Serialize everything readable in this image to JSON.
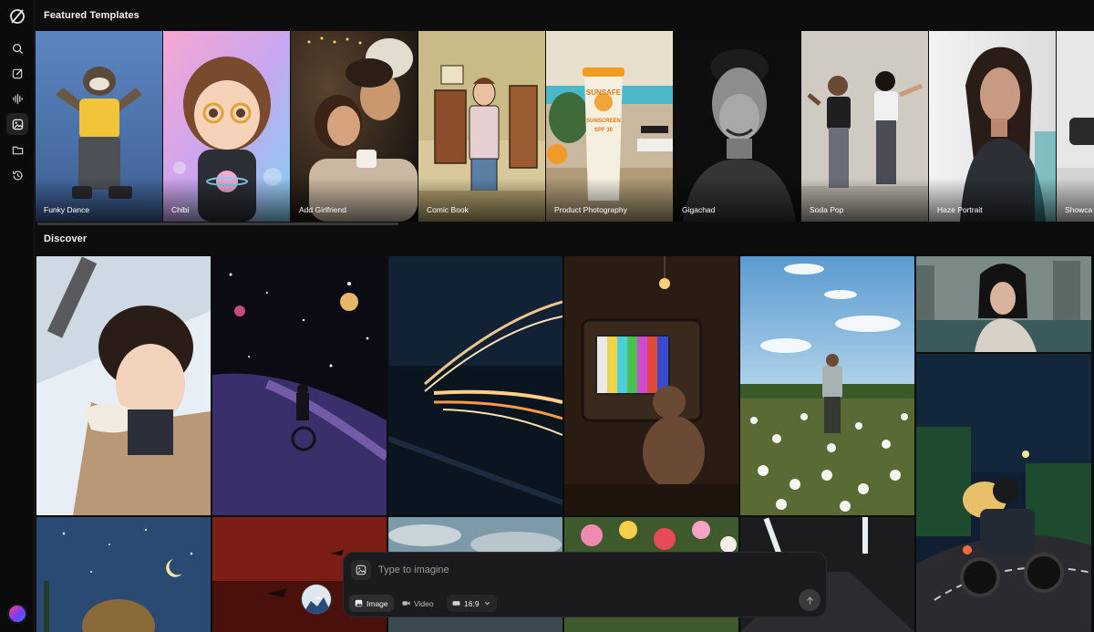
{
  "sections": {
    "featured_title": "Featured Templates",
    "discover_title": "Discover"
  },
  "templates": [
    {
      "label": "Funky Dance"
    },
    {
      "label": "Chibi"
    },
    {
      "label": "Add Girlfriend"
    },
    {
      "label": "Comic Book"
    },
    {
      "label": "Product Photography"
    },
    {
      "label": "Gigachad"
    },
    {
      "label": "Soda Pop"
    },
    {
      "label": "Haze Portrait"
    },
    {
      "label": "Showca"
    }
  ],
  "product": {
    "brand": "SUNSAFE",
    "line": "SUNSCREEN",
    "spf": "SPF 30"
  },
  "prompt": {
    "placeholder": "Type to imagine",
    "mode_image": "Image",
    "mode_video": "Video",
    "aspect": "16:9"
  },
  "icons": {
    "logo": "logo-icon",
    "search": "search-icon",
    "edit": "edit-icon",
    "audio": "waveform-icon",
    "gallery": "gallery-icon",
    "folder": "folder-icon",
    "history": "history-icon"
  },
  "colors": {
    "background": "#0d0d0e",
    "sidebar": "#0b0b0c",
    "prompt_bg": "#1b1b1d",
    "text": "#e8e8e8"
  }
}
